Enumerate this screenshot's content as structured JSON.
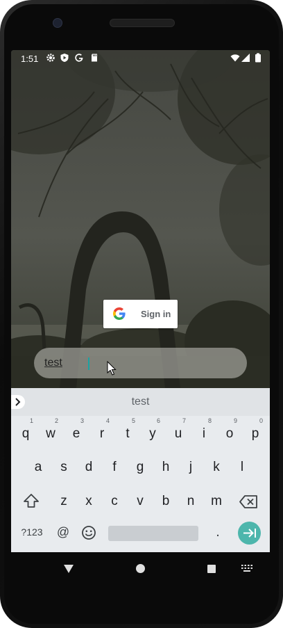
{
  "status_bar": {
    "time": "1:51",
    "left_icons": [
      "gear-icon",
      "play-protect-icon",
      "google-icon",
      "sd-card-icon"
    ],
    "right_icons": [
      "wifi-icon",
      "signal-icon",
      "battery-icon"
    ]
  },
  "signin_button": {
    "label": "Sign in",
    "icon": "google-logo-icon"
  },
  "input": {
    "value": "test"
  },
  "keyboard": {
    "suggestion": "test",
    "row1": [
      {
        "k": "q",
        "n": "1"
      },
      {
        "k": "w",
        "n": "2"
      },
      {
        "k": "e",
        "n": "3"
      },
      {
        "k": "r",
        "n": "4"
      },
      {
        "k": "t",
        "n": "5"
      },
      {
        "k": "y",
        "n": "6"
      },
      {
        "k": "u",
        "n": "7"
      },
      {
        "k": "i",
        "n": "8"
      },
      {
        "k": "o",
        "n": "9"
      },
      {
        "k": "p",
        "n": "0"
      }
    ],
    "row2": [
      "a",
      "s",
      "d",
      "f",
      "g",
      "h",
      "j",
      "k",
      "l"
    ],
    "row3": [
      "z",
      "x",
      "c",
      "v",
      "b",
      "n",
      "m"
    ],
    "symbols_label": "?123",
    "at_label": "@",
    "period_label": "."
  },
  "nav_bar": {
    "icons": [
      "back-icon",
      "home-icon",
      "recents-icon",
      "keyboard-switch-icon"
    ]
  },
  "colors": {
    "accent": "#4db6ac",
    "caret": "#1aa3a3",
    "keyboard_bg": "#e8ebee"
  }
}
